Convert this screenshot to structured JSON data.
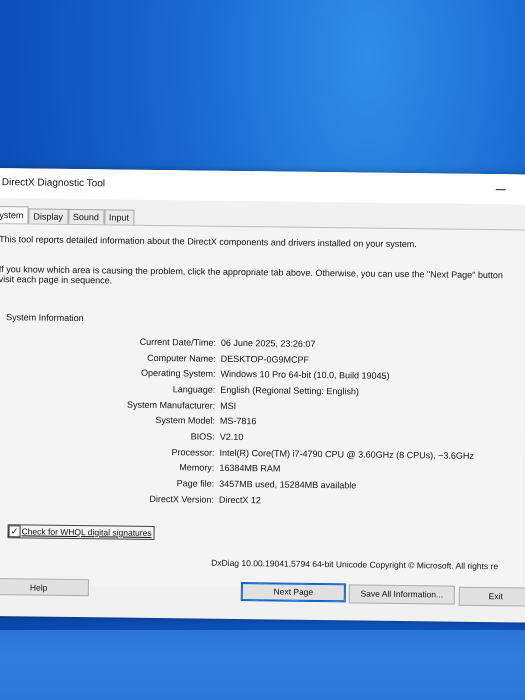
{
  "window": {
    "title": "DirectX Diagnostic Tool"
  },
  "tabs": [
    {
      "label": "ystem"
    },
    {
      "label": "Display"
    },
    {
      "label": "Sound"
    },
    {
      "label": "Input"
    }
  ],
  "system_tab": {
    "intro": "This tool reports detailed information about the DirectX components and drivers installed on your system.",
    "hint_line1": "If you know which area is causing the problem, click the appropriate tab above.  Otherwise, you can use the \"Next Page\" button",
    "hint_line2": "visit each page in sequence.",
    "section_title": "System Information",
    "info": [
      {
        "label": "Current Date/Time:",
        "value": "06 June 2025, 23:26:07"
      },
      {
        "label": "Computer Name:",
        "value": "DESKTOP-0G9MCPF"
      },
      {
        "label": "Operating System:",
        "value": "Windows 10 Pro 64-bit (10.0, Build 19045)"
      },
      {
        "label": "Language:",
        "value": "English (Regional Setting: English)"
      },
      {
        "label": "System Manufacturer:",
        "value": "MSI"
      },
      {
        "label": "System Model:",
        "value": "MS-7816"
      },
      {
        "label": "BIOS:",
        "value": "V2.10"
      },
      {
        "label": "Processor:",
        "value": "Intel(R) Core(TM) i7-4790 CPU @ 3.60GHz (8 CPUs), ~3.6GHz"
      },
      {
        "label": "Memory:",
        "value": "16384MB RAM"
      },
      {
        "label": "Page file:",
        "value": "3457MB used, 15284MB available"
      },
      {
        "label": "DirectX Version:",
        "value": "DirectX 12"
      }
    ],
    "whql_checkbox": {
      "label": "Check for WHQL digital signatures",
      "check_glyph": "✓"
    }
  },
  "footer": {
    "version_text": "DxDiag 10.00.19041.5794 64-bit Unicode  Copyright © Microsoft. All rights re"
  },
  "buttons": {
    "help": "Help",
    "next_page": "Next Page",
    "save_all": "Save All Information...",
    "exit": "Exit"
  },
  "colors": {
    "desktop_blue": "#0d4fb8",
    "window_bg": "#f1f1f1",
    "focus_border": "#0a63c9"
  }
}
